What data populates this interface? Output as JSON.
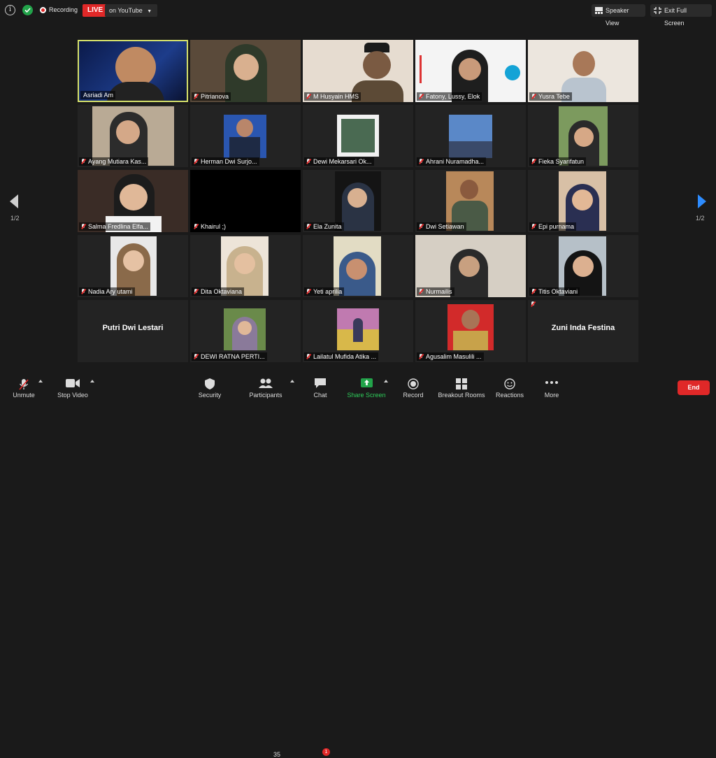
{
  "top": {
    "recording_label": "Recording",
    "live_label": "LIVE",
    "youtube_label": "on YouTube",
    "speaker_view_label": "Speaker View",
    "exit_full_screen_label": "Exit Full Screen"
  },
  "nav": {
    "page_left": "1/2",
    "page_right": "1/2"
  },
  "tiles": [
    {
      "name": "Asriadi Am",
      "active": true
    },
    {
      "name": "Pitrianova"
    },
    {
      "name": "M Husyain HMS"
    },
    {
      "name": "Fatony, Lussy, Elok"
    },
    {
      "name": "Yusra Tebe"
    },
    {
      "name": "Ayang Mutiara Kas..."
    },
    {
      "name": "Herman Dwi Surjo..."
    },
    {
      "name": "Dewi Mekarsari Ok..."
    },
    {
      "name": "Ahrani Nuramadha..."
    },
    {
      "name": "Fieka Syarifatun"
    },
    {
      "name": "Salma Fredlina Elfa..."
    },
    {
      "name": "Khairul ;)"
    },
    {
      "name": "Ela Zunita"
    },
    {
      "name": "Dwi Setiawan"
    },
    {
      "name": "Epi purnama"
    },
    {
      "name": "Nadia Ary utami"
    },
    {
      "name": "Dita Oktaviana"
    },
    {
      "name": "Yeti aprilia"
    },
    {
      "name": "Nurmailis"
    },
    {
      "name": "Titis Oktaviani"
    },
    {
      "name": "Putri Dwi Lestari"
    },
    {
      "name": "DEWI RATNA PERTI..."
    },
    {
      "name": "Lailatul Mufida Atika ..."
    },
    {
      "name": "Agusalim Masulili ..."
    },
    {
      "name": "Zuni Inda Festina"
    }
  ],
  "toolbar": {
    "unmute": "Unmute",
    "stop_video": "Stop Video",
    "security": "Security",
    "participants": "Participants",
    "participant_count": "35",
    "chat": "Chat",
    "chat_badge": "1",
    "share_screen": "Share Screen",
    "record": "Record",
    "breakout_rooms": "Breakout Rooms",
    "reactions": "Reactions",
    "more": "More",
    "end": "End"
  },
  "colors": {
    "background": "#1a1a1a",
    "live_red": "#e02828",
    "share_green": "#22a34a",
    "active_border": "#d5e06a",
    "nav_blue": "#2d8cff"
  }
}
